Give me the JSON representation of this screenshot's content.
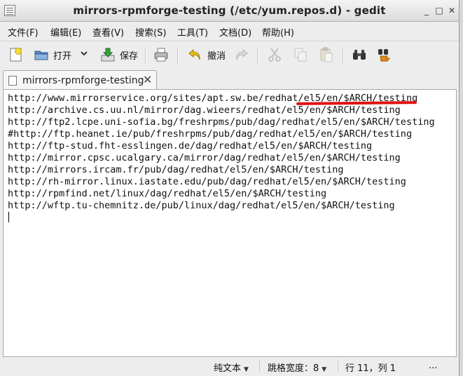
{
  "window": {
    "title": "mirrors-rpmforge-testing (/etc/yum.repos.d) - gedit",
    "controls": [
      "_",
      "□",
      "✕"
    ]
  },
  "menu": [
    "文件(F)",
    "编辑(E)",
    "查看(V)",
    "搜索(S)",
    "工具(T)",
    "文档(D)",
    "帮助(H)"
  ],
  "toolbar": {
    "new_icon": "new-document-icon",
    "open_label": "打开",
    "save_label": "保存",
    "undo_label": "撤消",
    "print_icon": "printer-icon",
    "redo_icon": "redo-icon",
    "cut_icon": "scissors-icon",
    "copy_icon": "copy-icon",
    "paste_icon": "paste-icon",
    "find_icon": "binoculars-icon",
    "replace_icon": "find-replace-icon"
  },
  "tab": {
    "label": "mirrors-rpmforge-testing"
  },
  "editor": {
    "lines": [
      "http://www.mirrorservice.org/sites/apt.sw.be/redhat/el5/en/$ARCH/testing",
      "http://archive.cs.uu.nl/mirror/dag.wieers/redhat/el5/en/$ARCH/testing",
      "http://ftp2.lcpe.uni-sofia.bg/freshrpms/pub/dag/redhat/el5/en/$ARCH/testing",
      "#http://ftp.heanet.ie/pub/freshrpms/pub/dag/redhat/el5/en/$ARCH/testing",
      "http://ftp-stud.fht-esslingen.de/dag/redhat/el5/en/$ARCH/testing",
      "http://mirror.cpsc.ucalgary.ca/mirror/dag/redhat/el5/en/$ARCH/testing",
      "http://mirrors.ircam.fr/pub/dag/redhat/el5/en/$ARCH/testing",
      "http://rh-mirror.linux.iastate.edu/pub/dag/redhat/el5/en/$ARCH/testing",
      "http://rpmfind.net/linux/dag/redhat/el5/en/$ARCH/testing",
      "http://wftp.tu-chemnitz.de/pub/linux/dag/redhat/el5/en/$ARCH/testing"
    ],
    "annotation_color": "#e01010"
  },
  "status": {
    "syntax": "纯文本",
    "tab_width_label": "跳格宽度：",
    "tab_width_value": "8",
    "position": "行 11，列 1",
    "mode": "..."
  }
}
